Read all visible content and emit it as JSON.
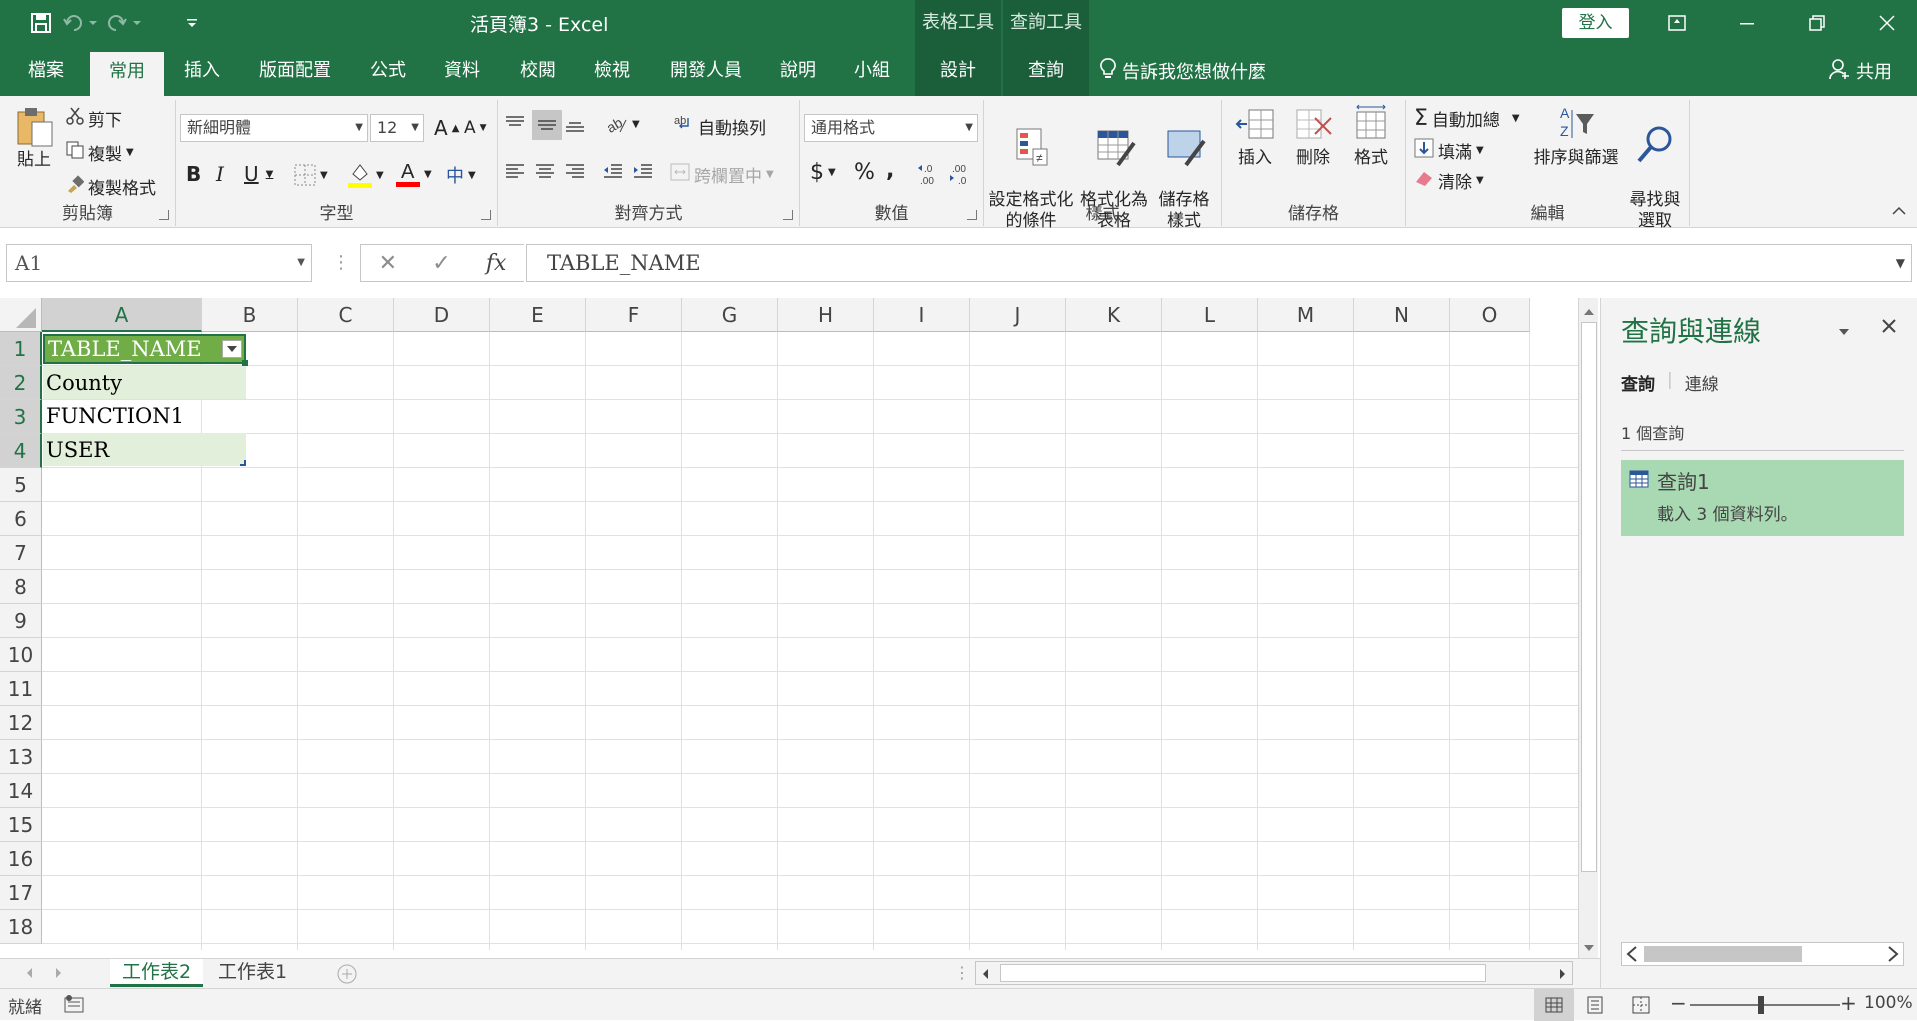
{
  "app": {
    "title": "活頁簿3  -  Excel",
    "context_groups": {
      "table_tools": "表格工具",
      "query_tools": "查詢工具"
    },
    "signin_label": "登入"
  },
  "tabs": [
    {
      "label": "檔案"
    },
    {
      "label": "常用"
    },
    {
      "label": "插入"
    },
    {
      "label": "版面配置"
    },
    {
      "label": "公式"
    },
    {
      "label": "資料"
    },
    {
      "label": "校閱"
    },
    {
      "label": "檢視"
    },
    {
      "label": "開發人員"
    },
    {
      "label": "說明"
    },
    {
      "label": "小組"
    },
    {
      "label": "設計"
    },
    {
      "label": "查詢"
    }
  ],
  "tell_me": "告訴我您想做什麼",
  "share": "共用",
  "ribbon": {
    "clipboard": {
      "group": "剪貼簿",
      "paste": "貼上",
      "cut": "剪下",
      "copy": "複製",
      "format_painter": "複製格式"
    },
    "font": {
      "group": "字型",
      "font_name": "新細明體",
      "font_size": "12"
    },
    "alignment": {
      "group": "對齊方式",
      "wrap_text": "自動換列",
      "merge_center": "跨欄置中"
    },
    "number": {
      "group": "數值",
      "format": "通用格式",
      "currency": "$",
      "percent": "%",
      "comma": ","
    },
    "styles": {
      "group": "樣式",
      "conditional": "設定格式化\n的條件",
      "format_table": "格式化為\n表格",
      "cell_styles": "儲存格\n樣式"
    },
    "cells": {
      "group": "儲存格",
      "insert": "插入",
      "delete": "刪除",
      "format": "格式"
    },
    "editing": {
      "group": "編輯",
      "autosum": "自動加總",
      "fill": "填滿",
      "clear": "清除",
      "sort_filter": "排序與篩選",
      "find_select": "尋找與\n選取"
    }
  },
  "formula_bar": {
    "name_box": "A1",
    "fx": "fx",
    "content": "TABLE_NAME"
  },
  "grid": {
    "columns": [
      "A",
      "B",
      "C",
      "D",
      "E",
      "F",
      "G",
      "H",
      "I",
      "J",
      "K",
      "L",
      "M",
      "N",
      "O"
    ],
    "rows": [
      "1",
      "2",
      "3",
      "4",
      "5",
      "6",
      "7",
      "8",
      "9",
      "10",
      "11",
      "12",
      "13",
      "14",
      "15",
      "16",
      "17",
      "18"
    ],
    "cells": [
      "TABLE_NAME",
      "County",
      "FUNCTION1",
      "USER"
    ]
  },
  "query_pane": {
    "title": "查詢與連線",
    "tab_queries": "查詢",
    "tab_connections": "連線",
    "count": "1 個查詢",
    "item_name": "查詢1",
    "item_status": "載入 3 個資料列。"
  },
  "sheets": [
    "工作表2",
    "工作表1"
  ],
  "status": {
    "ready": "就緒",
    "zoom": "100%"
  },
  "colors": {
    "accent": "#217346",
    "table_header": "#70ad47",
    "table_band": "#e2efda",
    "query_item": "#a9d9b2"
  }
}
